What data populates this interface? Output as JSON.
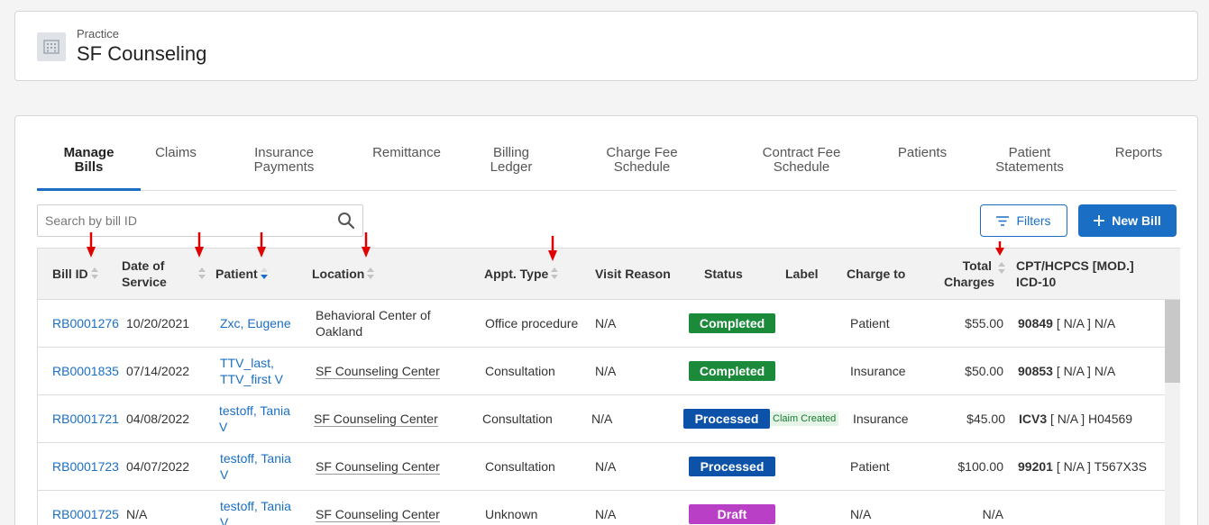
{
  "practice": {
    "label": "Practice",
    "name": "SF Counseling",
    "icon": "building-icon"
  },
  "tabs": [
    {
      "label": "Manage\nBills",
      "active": true
    },
    {
      "label": "Claims"
    },
    {
      "label": "Insurance\nPayments"
    },
    {
      "label": "Remittance"
    },
    {
      "label": "Billing\nLedger"
    },
    {
      "label": "Charge Fee\nSchedule"
    },
    {
      "label": "Contract Fee\nSchedule"
    },
    {
      "label": "Patients"
    },
    {
      "label": "Patient\nStatements"
    },
    {
      "label": "Reports"
    }
  ],
  "search": {
    "placeholder": "Search by bill ID",
    "value": ""
  },
  "toolbar": {
    "filters_label": "Filters",
    "new_bill_label": "New Bill"
  },
  "columns": {
    "bill_id": "Bill ID",
    "date_of_service": "Date of\nService",
    "patient": "Patient",
    "location": "Location",
    "appt_type": "Appt. Type",
    "visit_reason": "Visit Reason",
    "status": "Status",
    "label": "Label",
    "charge_to": "Charge to",
    "total_charges": "Total\nCharges",
    "cpt_icd": "CPT/HCPCS [MOD.]\nICD-10"
  },
  "rows": [
    {
      "bill_id": "RB0001276",
      "date": "10/20/2021",
      "patient": "Zxc, Eugene",
      "location": "Behavioral Center of\nOakland",
      "appt_type": "Office procedure",
      "visit_reason": "N/A",
      "status": "Completed",
      "label": "",
      "charge_to": "Patient",
      "total": "$55.00",
      "cpt_code": "90849",
      "cpt_rest": " [ N/A ] N/A"
    },
    {
      "bill_id": "RB0001835",
      "date": "07/14/2022",
      "patient": "TTV_last,\nTTV_first V",
      "location": "SF Counseling Center",
      "appt_type": "Consultation",
      "visit_reason": "N/A",
      "status": "Completed",
      "label": "",
      "charge_to": "Insurance",
      "total": "$50.00",
      "cpt_code": "90853",
      "cpt_rest": " [ N/A ] N/A"
    },
    {
      "bill_id": "RB0001721",
      "date": "04/08/2022",
      "patient": "testoff, Tania\nV",
      "location": "SF Counseling Center",
      "appt_type": "Consultation",
      "visit_reason": "N/A",
      "status": "Processed",
      "label": "Claim Created",
      "charge_to": "Insurance",
      "total": "$45.00",
      "cpt_code": "ICV3",
      "cpt_rest": " [ N/A ] H04569"
    },
    {
      "bill_id": "RB0001723",
      "date": "04/07/2022",
      "patient": "testoff, Tania\nV",
      "location": "SF Counseling Center",
      "appt_type": "Consultation",
      "visit_reason": "N/A",
      "status": "Processed",
      "label": "",
      "charge_to": "Patient",
      "total": "$100.00",
      "cpt_code": "99201",
      "cpt_rest": " [ N/A ] T567X3S"
    },
    {
      "bill_id": "RB0001725",
      "date": "N/A",
      "patient": "testoff, Tania\nV",
      "location": "SF Counseling Center",
      "appt_type": "Unknown",
      "visit_reason": "N/A",
      "status": "Draft",
      "label": "",
      "charge_to": "N/A",
      "total": "N/A",
      "cpt_code": "",
      "cpt_rest": ""
    }
  ],
  "colors": {
    "accent": "#1a6fc4",
    "completed": "#1b8a3a",
    "processed": "#0b52a8",
    "draft": "#b83fc6",
    "annotation_arrow": "#e00000"
  }
}
